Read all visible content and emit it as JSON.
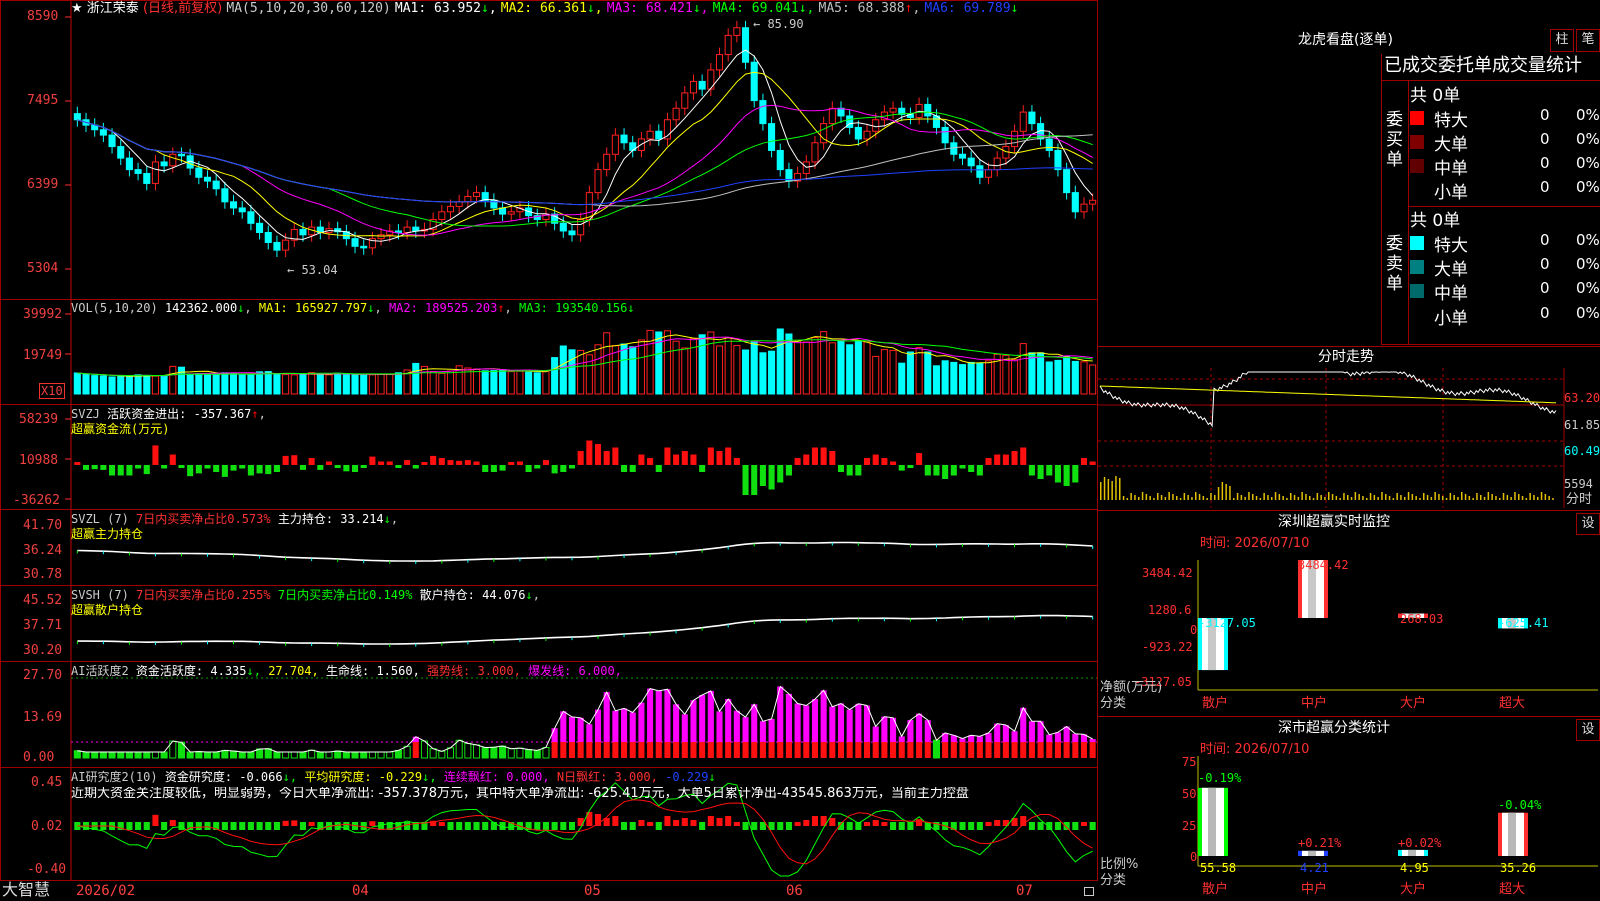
{
  "stock": {
    "name": "浙江荣泰",
    "mode": "(日线,前复权)",
    "star": "★"
  },
  "colors": {
    "up": "#ff2020",
    "down": "#00ffff",
    "ma1": "#ffffff",
    "ma2": "#ffff00",
    "ma3": "#ff00ff",
    "ma4": "#00ff00",
    "ma5": "#c0c0c0",
    "ma6": "#2040ff",
    "axis": "#ff3030",
    "grid": "#a00000"
  },
  "main_chart": {
    "ma_title": "MA(5,10,20,30,60,120)",
    "ma_values": [
      {
        "label": "MA1:",
        "value": "63.952",
        "arrow": "↓"
      },
      {
        "label": "MA2:",
        "value": "66.361",
        "arrow": "↓"
      },
      {
        "label": "MA3:",
        "value": "68.421",
        "arrow": "↓"
      },
      {
        "label": "MA4:",
        "value": "69.041",
        "arrow": "↓"
      },
      {
        "label": "MA5:",
        "value": "68.388",
        "arrow": "↑"
      },
      {
        "label": "MA6:",
        "value": "69.789",
        "arrow": "↓"
      }
    ],
    "y_ticks": [
      "8590",
      "7495",
      "6399",
      "5304"
    ],
    "high_mark": "85.90",
    "low_mark": "53.04"
  },
  "vol_panel": {
    "title": "VOL(5,10,20)",
    "value": "142362.000",
    "arrow": "↓",
    "ma1": "MA1: 165927.797",
    "ma1_arrow": "↓",
    "ma2": "MA2: 189525.203",
    "ma2_arrow": "↑",
    "ma3": "MA3: 193540.156",
    "ma3_arrow": "↓",
    "y_ticks": [
      "39992",
      "19749"
    ],
    "unit": "X10"
  },
  "svzj_panel": {
    "title": "SVZJ",
    "text": "活跃资金进出: -357.367",
    "arrow": "↑",
    "sub": "超赢资金流(万元)",
    "y_ticks": [
      "58239",
      "10988",
      "-36262"
    ]
  },
  "svzl_panel": {
    "title": "SVZL (7)",
    "t1": "7日内买卖净占比0.573%",
    "t2": "主力持仓: 33.214",
    "arrow": "↓",
    "sub": "超赢主力持仓",
    "y_ticks": [
      "41.70",
      "36.24",
      "30.78"
    ]
  },
  "svsh_panel": {
    "title": "SVSH (7)",
    "t1": "7日内买卖净占比0.255%",
    "t2": "7日内买卖净占比0.149%",
    "t3": "散户持仓: 44.076",
    "arrow": "↓",
    "sub": "超赢散户持仓",
    "y_ticks": [
      "45.52",
      "37.71",
      "30.20"
    ]
  },
  "ai1_panel": {
    "title": "AI活跃度2",
    "t1": "资金活跃度: 4.335",
    "t2": "27.704,",
    "t3": "生命线: 1.560,",
    "t4": "强势线: 3.000,",
    "t5": "爆发线: 6.000,",
    "y_ticks": [
      "27.70",
      "13.69",
      "0.00"
    ]
  },
  "ai2_panel": {
    "title": "AI研究度2(10)",
    "t1": "资金研究度: -0.066",
    "t2": "平均研究度: -0.229",
    "t3": "连续飘红: 0.000,",
    "t4": "N日飘红: 3.000,",
    "t5": "-0.229",
    "message": "近期大资金关注度较低，明显弱势，今日大单净流出: -357.378万元，其中特大单净流出: -625.41万元，大单5日累计净出-43545.863万元，当前主力控盘",
    "y_ticks": [
      "0.45",
      "0.02",
      "-0.40"
    ]
  },
  "bottom_bar": {
    "brand": "大智慧",
    "months": [
      "2026/02",
      "04",
      "05",
      "06",
      "07"
    ]
  },
  "right": {
    "title": "龙虎看盘(逐单)",
    "btn1": "柱",
    "btn2": "笔",
    "stat_title": "已成交委托单成交量统计",
    "buy": {
      "side": "委买单",
      "total": "共 0单",
      "rows": [
        {
          "label": "特大",
          "v": "0",
          "p": "0%"
        },
        {
          "label": "大单",
          "v": "0",
          "p": "0%"
        },
        {
          "label": "中单",
          "v": "0",
          "p": "0%"
        },
        {
          "label": "小单",
          "v": "0",
          "p": "0%"
        }
      ]
    },
    "sell": {
      "side": "委卖单",
      "total": "共 0单",
      "rows": [
        {
          "label": "特大",
          "v": "0",
          "p": "0%"
        },
        {
          "label": "大单",
          "v": "0",
          "p": "0%"
        },
        {
          "label": "中单",
          "v": "0",
          "p": "0%"
        },
        {
          "label": "小单",
          "v": "0",
          "p": "0%"
        }
      ]
    },
    "intraday": {
      "title": "分时走势",
      "y_ticks": [
        "63.20",
        "61.85",
        "60.49"
      ],
      "vol_label": "5594",
      "vol_sub": "分时"
    },
    "monitor": {
      "title": "深圳超赢实时监控",
      "settings": "设",
      "time": "时间: 2026/07/10",
      "y_ticks": [
        "3484.42",
        "1280.6",
        "0",
        "-923.22",
        "-3127.05"
      ],
      "bars": [
        {
          "cat": "散户",
          "value": "-3127.05"
        },
        {
          "cat": "中户",
          "value": "3484.42"
        },
        {
          "cat": "大户",
          "value": "268.03"
        },
        {
          "cat": "超大",
          "value": "-625.41"
        }
      ],
      "ylabel": "净额(万元)",
      "xlabel": "分类"
    },
    "classify": {
      "title": "深市超赢分类统计",
      "settings": "设",
      "time": "时间: 2026/07/10",
      "y_ticks": [
        "75",
        "50",
        "25",
        "0"
      ],
      "bars": [
        {
          "cat": "散户",
          "pct": "-0.19%",
          "ratio": "55.58"
        },
        {
          "cat": "中户",
          "pct": "+0.21%",
          "ratio": "4.21"
        },
        {
          "cat": "大户",
          "pct": "+0.02%",
          "ratio": "4.95"
        },
        {
          "cat": "超大",
          "pct": "-0.04%",
          "ratio": "35.26"
        }
      ],
      "ylabel": "比例%",
      "xlabel": "分类"
    }
  },
  "chart_data": {
    "type": "candlestick",
    "title": "浙江荣泰 (日线,前复权)",
    "ylim": [
      53.04,
      85.9
    ],
    "high": 85.9,
    "low": 53.04,
    "closes": [
      72.5,
      71.8,
      71.2,
      70.5,
      69.0,
      67.5,
      66.0,
      65.5,
      64.2,
      67.0,
      66.5,
      68.0,
      67.8,
      66.2,
      65.0,
      64.5,
      63.5,
      61.8,
      61.0,
      60.5,
      59.0,
      57.8,
      56.5,
      55.5,
      56.8,
      58.2,
      57.5,
      58.5,
      57.8,
      58.3,
      57.9,
      57.0,
      56.0,
      55.8,
      57.0,
      57.5,
      58.0,
      57.8,
      58.5,
      58.0,
      58.2,
      59.5,
      60.5,
      61.2,
      61.8,
      62.5,
      63.0,
      62.0,
      61.0,
      60.2,
      60.5,
      61.0,
      60.0,
      59.5,
      60.2,
      59.0,
      58.0,
      57.5,
      59.5,
      63.0,
      66.0,
      68.0,
      70.5,
      69.5,
      68.5,
      70.0,
      71.0,
      70.0,
      72.5,
      74.0,
      76.0,
      77.5,
      76.5,
      79.0,
      81.0,
      83.5,
      84.5,
      80.0,
      75.0,
      72.0,
      68.5,
      66.0,
      64.5,
      65.5,
      67.0,
      69.5,
      72.0,
      74.0,
      73.0,
      71.5,
      70.0,
      71.0,
      72.5,
      73.5,
      74.0,
      73.2,
      72.8,
      74.5,
      73.0,
      71.5,
      69.5,
      68.0,
      67.5,
      66.5,
      65.0,
      66.0,
      67.5,
      69.0,
      71.0,
      73.5,
      72.0,
      70.0,
      68.5,
      66.0,
      63.0,
      60.5,
      61.5,
      62.0
    ],
    "volumes": [
      10500,
      9800,
      9200,
      9000,
      8500,
      8700,
      9100,
      9600,
      9300,
      9000,
      9200,
      13800,
      13400,
      9800,
      10200,
      9600,
      9900,
      10600,
      10400,
      9600,
      9500,
      11100,
      11200,
      9900,
      9700,
      9600,
      9800,
      10700,
      9900,
      9600,
      10400,
      9900,
      9800,
      9700,
      9600,
      9800,
      9900,
      10600,
      12000,
      15300,
      13800,
      11200,
      10300,
      11500,
      14100,
      13000,
      12500,
      11600,
      11700,
      12100,
      11200,
      11400,
      10900,
      10600,
      11600,
      18200,
      24000,
      22100,
      21800,
      19600,
      24600,
      30600,
      24200,
      25000,
      23600,
      27000,
      31800,
      31000,
      31600,
      26400,
      23000,
      27800,
      29600,
      31000,
      24000,
      28200,
      24200,
      22000,
      26400,
      20600,
      21400,
      32500,
      30000,
      26700,
      26000,
      28200,
      31200,
      25600,
      26700,
      24600,
      26600,
      26000,
      18800,
      22200,
      21800,
      15400,
      21000,
      23200,
      21000,
      14100,
      16600,
      15800,
      14700,
      15800,
      15400,
      16600,
      19800,
      19300,
      17200,
      25200,
      20600,
      20600,
      16000,
      16800,
      18800,
      16300,
      16100,
      14500
    ]
  }
}
